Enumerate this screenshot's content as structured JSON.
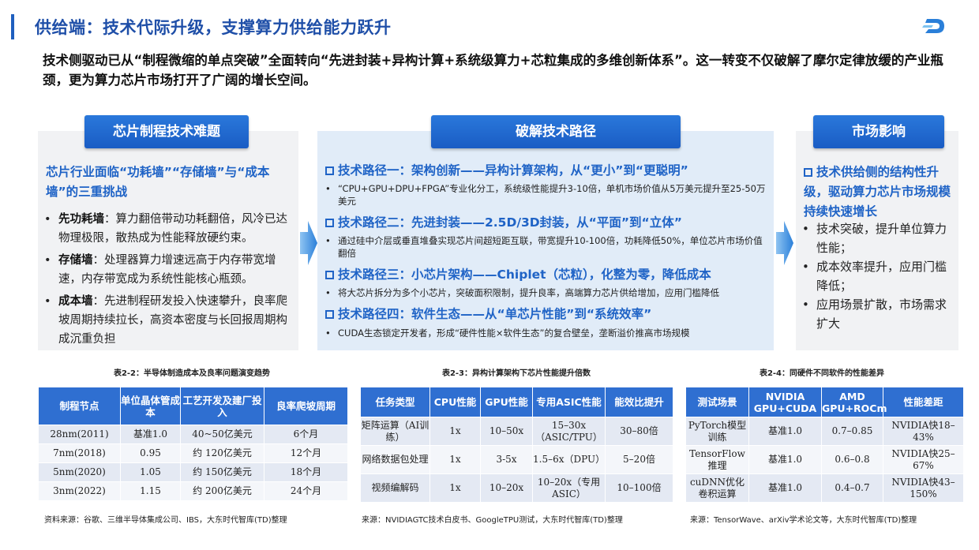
{
  "header": {
    "title": "供给端：技术代际升级，支撑算力供给能力跃升",
    "intro": "技术侧驱动已从“制程微缩的单点突破”全面转向“先进封装+异构计算+系统级算力+芯粒集成的多维创新体系”。这一转变不仅破解了摩尔定律放缓的产业瓶颈，更为算力芯片市场打开了广阔的增长空间。"
  },
  "colors": {
    "accent": "#1f63c6",
    "header_blue": "#2f6fd1",
    "panel_gray": "#f1f2f4",
    "panel_blue": "#e1ecf8"
  },
  "left_panel": {
    "heading": "芯片制程技术难题",
    "lead": "芯片行业面临“功耗墙”“存储墙”与“成本墙”的三重挑战",
    "bullets": [
      {
        "term": "先功耗墙",
        "text": "：算力翻倍带动功耗翻倍，风冷已达物理极限，散热成为性能释放硬约束。"
      },
      {
        "term": "存储墙",
        "text": "：处理器算力增速远高于内存带宽增速，内存带宽成为系统性能核心瓶颈。"
      },
      {
        "term": "成本墙",
        "text": "：先进制程研发投入快速攀升，良率爬坡周期持续拉长，高资本密度与长回报周期构成沉重负担"
      }
    ]
  },
  "middle_panel": {
    "heading": "破解技术路径",
    "routes": [
      {
        "title": "技术路径一：架构创新——异构计算架构，从“更小”到“更聪明”",
        "detail": "“CPU+GPU+DPU+FPGA”专业化分工，系统级性能提升3-10倍，单机市场价值从5万美元提升至25-50万美元"
      },
      {
        "title": "技术路径二：先进封装——2.5D/3D封装，从“平面”到“立体”",
        "detail": "通过硅中介层或垂直堆叠实现芯片间超短距互联，带宽提升10-100倍，功耗降低50%，单位芯片市场价值翻倍"
      },
      {
        "title": "技术路径三：小芯片架构——Chiplet（芯粒），化整为零，降低成本",
        "detail": "将大芯片拆分为多个小芯片，突破面积限制，提升良率，高端算力芯片供给增加，应用门槛降低"
      },
      {
        "title": "技术路径四：软件生态——从“单芯片性能”到“系统效率”",
        "detail": "CUDA生态锁定开发者，形成“硬件性能×软件生态”的复合壁垒，垄断溢价推高市场规模"
      }
    ]
  },
  "right_panel": {
    "heading": "市场影响",
    "lead": "技术供给侧的结构性升级，驱动算力芯片市场规模持续快速增长",
    "bullets": [
      "技术突破，提升单位算力性能；",
      "成本效率提升，应用门槛降低；",
      "应用场景扩散，市场需求扩大"
    ]
  },
  "tables": [
    {
      "caption": "表2-2：半导体制造成本及良率问题演变趋势",
      "headers": [
        "制程节点",
        "单位晶体管成本",
        "工艺开发及建厂投入",
        "良率爬坡周期"
      ],
      "rows": [
        [
          "28nm(2011)",
          "基准1.0",
          "40~50亿美元",
          "6个月"
        ],
        [
          "7nm(2018)",
          "0.95",
          "约 120亿美元",
          "12个月"
        ],
        [
          "5nm(2020)",
          "1.05",
          "约 150亿美元",
          "18个月"
        ],
        [
          "3nm(2022)",
          "1.15",
          "约 200亿美元",
          "24个月"
        ]
      ],
      "source": "资料来源：谷歌、三维半导体集成公司、IBS，大东时代智库(TD)整理"
    },
    {
      "caption": "表2-3：异构计算架构下芯片性能提升倍数",
      "headers": [
        "任务类型",
        "CPU性能",
        "GPU性能",
        "专用ASIC性能",
        "能效比提升"
      ],
      "rows": [
        [
          "矩阵运算（AI训练）",
          "1x",
          "10–50x",
          "15–30x（ASIC/TPU）",
          "30–80倍"
        ],
        [
          "网络数据包处理",
          "1x",
          "3-5x",
          "1.5–6x（DPU）",
          "5–20倍"
        ],
        [
          "视频编解码",
          "1x",
          "10–20x",
          "10–20x（专用ASIC）",
          "10–100倍"
        ]
      ],
      "source": "来源：NVIDIAGTC技术白皮书、GoogleTPU测试，大东时代智库(TD)整理"
    },
    {
      "caption": "表2-4：同硬件不同软件的性能差异",
      "headers": [
        "测试场景",
        "NVIDIA GPU+CUDA",
        "AMD GPU+ROCm",
        "性能差距"
      ],
      "rows": [
        [
          "PyTorch模型训练",
          "基准1.0",
          "0.7–0.85",
          "NVIDIA快18–43%"
        ],
        [
          "TensorFlow推理",
          "基准1.0",
          "0.6–0.8",
          "NVIDIA快25–67%"
        ],
        [
          "cuDNN优化卷积运算",
          "基准1.0",
          "0.4–0.7",
          "NVIDIA快43–150%"
        ]
      ],
      "source": "来源：TensorWave、arXiv学术论文等，大东时代智库(TD)整理"
    }
  ]
}
